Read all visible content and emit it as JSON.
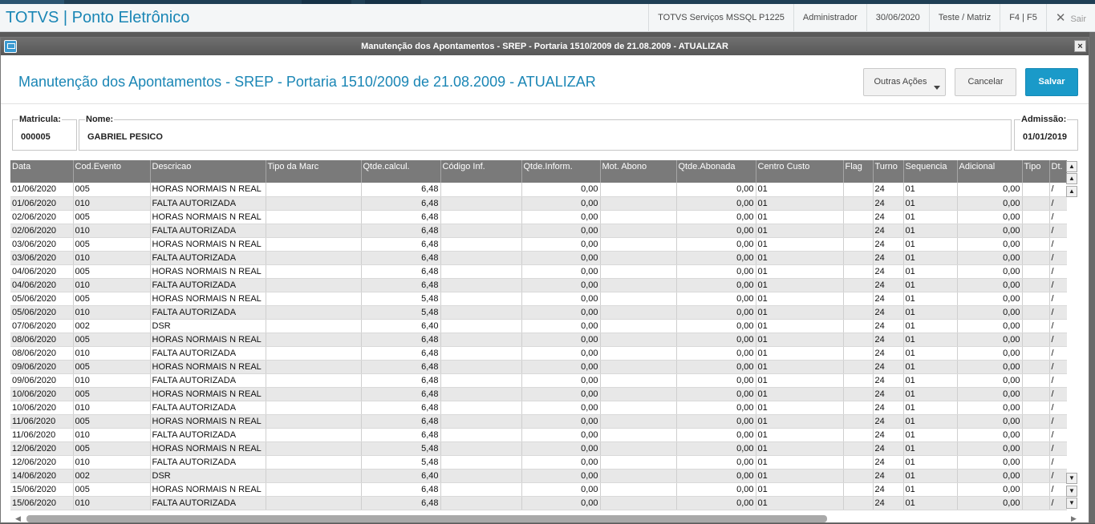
{
  "app": {
    "title": "TOTVS | Ponto Eletrônico"
  },
  "topbar": {
    "environment": "TOTVS Serviços MSSQL P1225",
    "user": "Administrador",
    "date": "30/06/2020",
    "company": "Teste / Matriz",
    "keys": "F4 | F5",
    "exit": "Sair"
  },
  "dialog": {
    "window_title": "Manutenção dos Apontamentos - SREP - Portaria 1510/2009 de 21.08.2009 - ATUALIZAR",
    "page_title": "Manutenção dos Apontamentos - SREP - Portaria 1510/2009 de 21.08.2009 - ATUALIZAR",
    "close_glyph": "×"
  },
  "actions": {
    "other": "Outras Ações",
    "cancel": "Cancelar",
    "save": "Salvar"
  },
  "fields": {
    "matricula": {
      "label": "Matricula:",
      "value": "000005"
    },
    "nome": {
      "label": "Nome:",
      "value": "GABRIEL PESICO"
    },
    "admissao": {
      "label": "Admissão:",
      "value": "01/01/2019"
    }
  },
  "table": {
    "columns": [
      "Data",
      "Cod.Evento",
      "Descricao",
      "Tipo da Marc",
      "Qtde.calcul.",
      "Código Inf.",
      "Qtde.Inform.",
      "Mot. Abono",
      "Qtde.Abonada",
      "Centro Custo",
      "Flag",
      "Turno",
      "Sequencia",
      "Adicional",
      "Tipo",
      "Dt."
    ],
    "rows": [
      [
        "01/06/2020",
        "005",
        "HORAS NORMAIS N REAL",
        "",
        "6,48",
        "",
        "0,00",
        "",
        "0,00",
        "01",
        "",
        "24",
        "01",
        "0,00",
        "",
        "/"
      ],
      [
        "01/06/2020",
        "010",
        "FALTA AUTORIZADA",
        "",
        "6,48",
        "",
        "0,00",
        "",
        "0,00",
        "01",
        "",
        "24",
        "01",
        "0,00",
        "",
        "/"
      ],
      [
        "02/06/2020",
        "005",
        "HORAS NORMAIS N REAL",
        "",
        "6,48",
        "",
        "0,00",
        "",
        "0,00",
        "01",
        "",
        "24",
        "01",
        "0,00",
        "",
        "/"
      ],
      [
        "02/06/2020",
        "010",
        "FALTA AUTORIZADA",
        "",
        "6,48",
        "",
        "0,00",
        "",
        "0,00",
        "01",
        "",
        "24",
        "01",
        "0,00",
        "",
        "/"
      ],
      [
        "03/06/2020",
        "005",
        "HORAS NORMAIS N REAL",
        "",
        "6,48",
        "",
        "0,00",
        "",
        "0,00",
        "01",
        "",
        "24",
        "01",
        "0,00",
        "",
        "/"
      ],
      [
        "03/06/2020",
        "010",
        "FALTA AUTORIZADA",
        "",
        "6,48",
        "",
        "0,00",
        "",
        "0,00",
        "01",
        "",
        "24",
        "01",
        "0,00",
        "",
        "/"
      ],
      [
        "04/06/2020",
        "005",
        "HORAS NORMAIS N REAL",
        "",
        "6,48",
        "",
        "0,00",
        "",
        "0,00",
        "01",
        "",
        "24",
        "01",
        "0,00",
        "",
        "/"
      ],
      [
        "04/06/2020",
        "010",
        "FALTA AUTORIZADA",
        "",
        "6,48",
        "",
        "0,00",
        "",
        "0,00",
        "01",
        "",
        "24",
        "01",
        "0,00",
        "",
        "/"
      ],
      [
        "05/06/2020",
        "005",
        "HORAS NORMAIS N REAL",
        "",
        "5,48",
        "",
        "0,00",
        "",
        "0,00",
        "01",
        "",
        "24",
        "01",
        "0,00",
        "",
        "/"
      ],
      [
        "05/06/2020",
        "010",
        "FALTA AUTORIZADA",
        "",
        "5,48",
        "",
        "0,00",
        "",
        "0,00",
        "01",
        "",
        "24",
        "01",
        "0,00",
        "",
        "/"
      ],
      [
        "07/06/2020",
        "002",
        "DSR",
        "",
        "6,40",
        "",
        "0,00",
        "",
        "0,00",
        "01",
        "",
        "24",
        "01",
        "0,00",
        "",
        "/"
      ],
      [
        "08/06/2020",
        "005",
        "HORAS NORMAIS N REAL",
        "",
        "6,48",
        "",
        "0,00",
        "",
        "0,00",
        "01",
        "",
        "24",
        "01",
        "0,00",
        "",
        "/"
      ],
      [
        "08/06/2020",
        "010",
        "FALTA AUTORIZADA",
        "",
        "6,48",
        "",
        "0,00",
        "",
        "0,00",
        "01",
        "",
        "24",
        "01",
        "0,00",
        "",
        "/"
      ],
      [
        "09/06/2020",
        "005",
        "HORAS NORMAIS N REAL",
        "",
        "6,48",
        "",
        "0,00",
        "",
        "0,00",
        "01",
        "",
        "24",
        "01",
        "0,00",
        "",
        "/"
      ],
      [
        "09/06/2020",
        "010",
        "FALTA AUTORIZADA",
        "",
        "6,48",
        "",
        "0,00",
        "",
        "0,00",
        "01",
        "",
        "24",
        "01",
        "0,00",
        "",
        "/"
      ],
      [
        "10/06/2020",
        "005",
        "HORAS NORMAIS N REAL",
        "",
        "6,48",
        "",
        "0,00",
        "",
        "0,00",
        "01",
        "",
        "24",
        "01",
        "0,00",
        "",
        "/"
      ],
      [
        "10/06/2020",
        "010",
        "FALTA AUTORIZADA",
        "",
        "6,48",
        "",
        "0,00",
        "",
        "0,00",
        "01",
        "",
        "24",
        "01",
        "0,00",
        "",
        "/"
      ],
      [
        "11/06/2020",
        "005",
        "HORAS NORMAIS N REAL",
        "",
        "6,48",
        "",
        "0,00",
        "",
        "0,00",
        "01",
        "",
        "24",
        "01",
        "0,00",
        "",
        "/"
      ],
      [
        "11/06/2020",
        "010",
        "FALTA AUTORIZADA",
        "",
        "6,48",
        "",
        "0,00",
        "",
        "0,00",
        "01",
        "",
        "24",
        "01",
        "0,00",
        "",
        "/"
      ],
      [
        "12/06/2020",
        "005",
        "HORAS NORMAIS N REAL",
        "",
        "5,48",
        "",
        "0,00",
        "",
        "0,00",
        "01",
        "",
        "24",
        "01",
        "0,00",
        "",
        "/"
      ],
      [
        "12/06/2020",
        "010",
        "FALTA AUTORIZADA",
        "",
        "5,48",
        "",
        "0,00",
        "",
        "0,00",
        "01",
        "",
        "24",
        "01",
        "0,00",
        "",
        "/"
      ],
      [
        "14/06/2020",
        "002",
        "DSR",
        "",
        "6,40",
        "",
        "0,00",
        "",
        "0,00",
        "01",
        "",
        "24",
        "01",
        "0,00",
        "",
        "/"
      ],
      [
        "15/06/2020",
        "005",
        "HORAS NORMAIS N REAL",
        "",
        "6,48",
        "",
        "0,00",
        "",
        "0,00",
        "01",
        "",
        "24",
        "01",
        "0,00",
        "",
        "/"
      ],
      [
        "15/06/2020",
        "010",
        "FALTA AUTORIZADA",
        "",
        "6,48",
        "",
        "0,00",
        "",
        "0,00",
        "01",
        "",
        "24",
        "01",
        "0,00",
        "",
        "/"
      ]
    ]
  },
  "icons": {
    "scroll_top": "double-arrow-up-icon",
    "scroll_up": "arrow-up-icon",
    "scroll_down": "arrow-down-icon",
    "scroll_bottom": "double-arrow-down-icon"
  },
  "colors": {
    "accent": "#1a86b5",
    "save_button": "#1a9ac9",
    "header_gray": "#7a7a7a"
  }
}
